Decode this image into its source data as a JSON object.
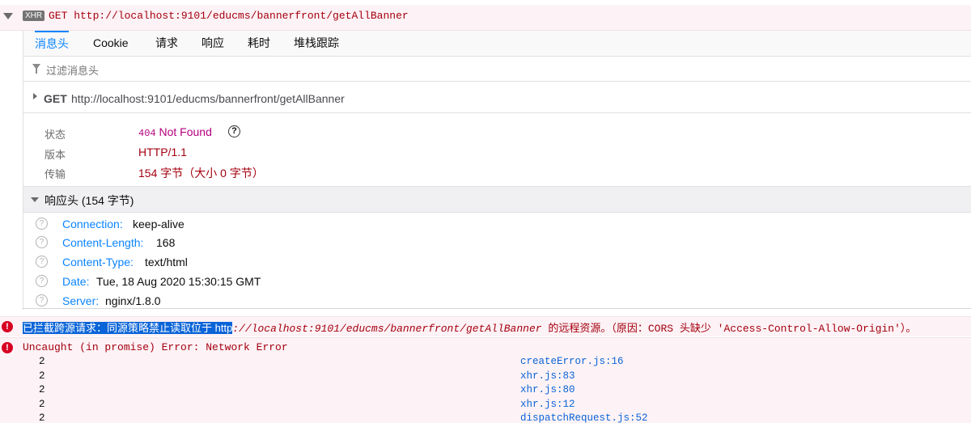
{
  "request": {
    "badge": "XHR",
    "summary": "GET http://localhost:9101/educms/bannerfront/getAllBanner"
  },
  "tabs": [
    "消息头",
    "Cookie",
    "请求",
    "响应",
    "耗时",
    "堆栈跟踪"
  ],
  "filter_placeholder": "过滤消息头",
  "request_line": {
    "method": "GET",
    "url": "http://localhost:9101/educms/bannerfront/getAllBanner"
  },
  "summary": {
    "status_label": "状态",
    "status_code": "404",
    "status_text": "Not Found",
    "version_label": "版本",
    "version_value": "HTTP/1.1",
    "transfer_label": "传输",
    "transfer_value": "154 字节（大小 0 字节）"
  },
  "response_headers": {
    "title": "响应头 (154 字节)",
    "items": [
      {
        "name": "Connection:",
        "value": "keep-alive"
      },
      {
        "name": "Content-Length:",
        "value": "168"
      },
      {
        "name": "Content-Type:",
        "value": "text/html"
      },
      {
        "name": "Date:",
        "value": "Tue, 18 Aug 2020 15:30:15 GMT"
      },
      {
        "name": "Server:",
        "value": "nginx/1.8.0"
      }
    ]
  },
  "cors_error": {
    "selected": "已拦截跨源请求：同源策略禁止读取位于 http",
    "rest_url": "://localhost:9101/educms/bannerfront/getAllBanner",
    "tail": " 的远程资源。（原因：CORS 头缺少 'Access-Control-Allow-Origin'）。"
  },
  "uncaught_error": "Uncaught (in promise) Error: Network Error",
  "stack": [
    {
      "count": "2",
      "location": "createError.js:16"
    },
    {
      "count": "2",
      "location": "xhr.js:83"
    },
    {
      "count": "2",
      "location": "xhr.js:80"
    },
    {
      "count": "2",
      "location": "xhr.js:12"
    },
    {
      "count": "2",
      "location": "dispatchRequest.js:52"
    }
  ],
  "colors": {
    "accent": "#0a84ff",
    "error": "#a4000f",
    "error_bg": "#fdf2f5",
    "status": "#b5007f"
  }
}
